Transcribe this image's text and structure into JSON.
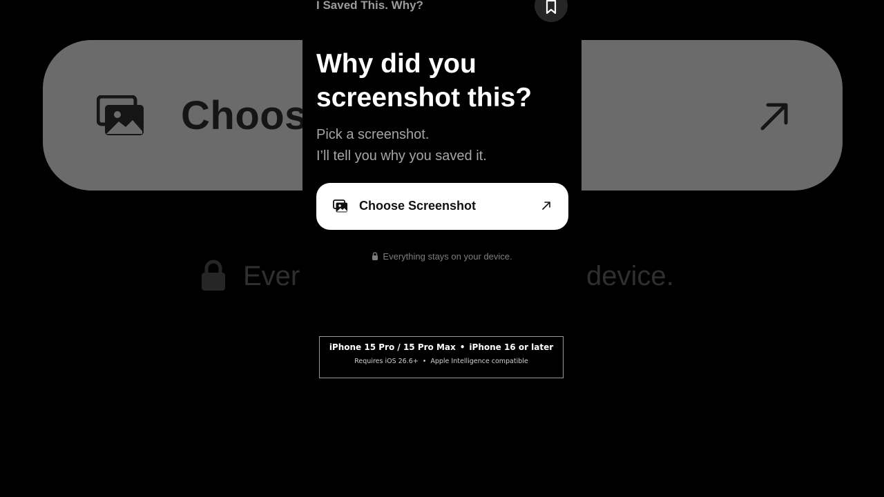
{
  "app": {
    "name": "I Saved This. Why?"
  },
  "background": {
    "button_label": "Choos",
    "note_left": "Ever",
    "note_right": "device."
  },
  "hero": {
    "headline_line1": "Why did you",
    "headline_line2": "screenshot this?",
    "subtitle_line1": "Pick a screenshot.",
    "subtitle_line2": "I’ll tell you why you saved it."
  },
  "actions": {
    "choose_label": "Choose Screenshot"
  },
  "privacy": {
    "text": "Everything stays on your device."
  },
  "compatibility": {
    "devices": [
      "iPhone 15 Pro / 15 Pro Max",
      "iPhone 16 or later"
    ],
    "requirements": [
      "Requires iOS 26.6+",
      "Apple Intelligence compatible"
    ],
    "separator": "•"
  },
  "icons": {
    "bookmark": "bookmark-icon",
    "gallery": "photo-gallery-icon",
    "arrow": "arrow-up-right-icon",
    "lock": "lock-icon"
  },
  "colors": {
    "background": "#000000",
    "button_bg": "#ffffff",
    "headline": "#ffffff",
    "subtitle": "#a6a6a6",
    "bg_card": "#6b6b6b"
  }
}
